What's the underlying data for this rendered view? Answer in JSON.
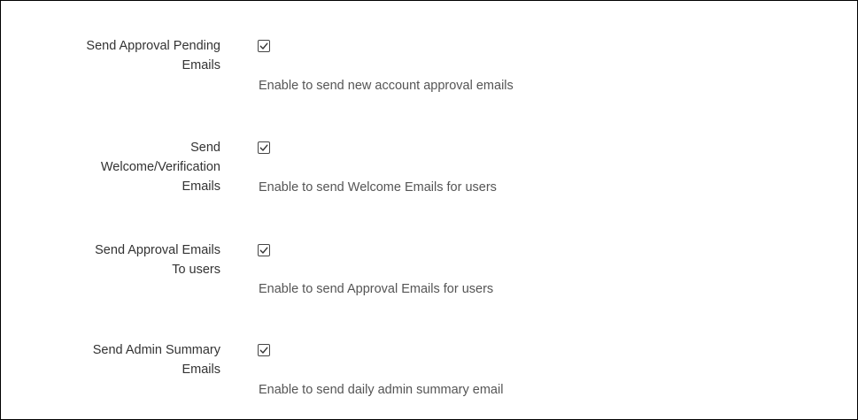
{
  "settings": [
    {
      "label": "Send Approval Pending\nEmails",
      "checked": true,
      "description": "Enable to send new account approval emails"
    },
    {
      "label": "Send\nWelcome/Verification\nEmails",
      "checked": true,
      "description": "Enable to send Welcome Emails for users"
    },
    {
      "label": "Send Approval Emails\nTo users",
      "checked": true,
      "description": "Enable to send Approval Emails for users"
    },
    {
      "label": "Send Admin Summary\nEmails",
      "checked": true,
      "description": "Enable to send daily admin summary email"
    }
  ],
  "icons": {
    "checkbox_mark": "check-icon"
  }
}
